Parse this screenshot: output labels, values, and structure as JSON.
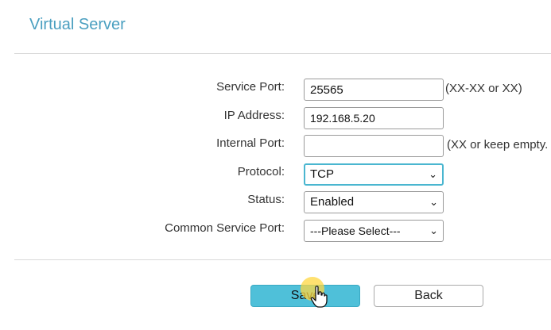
{
  "header": {
    "title": "Virtual Server"
  },
  "form": {
    "service_port": {
      "label": "Service Port:",
      "value": "25565",
      "hint": "(XX-XX or XX)"
    },
    "ip_address": {
      "label": "IP Address:",
      "value": "192.168.5.20"
    },
    "internal_port": {
      "label": "Internal Port:",
      "value": "",
      "hint": "(XX or keep empty."
    },
    "protocol": {
      "label": "Protocol:",
      "selected": "TCP"
    },
    "status": {
      "label": "Status:",
      "selected": "Enabled"
    },
    "common_service_port": {
      "label": "Common Service Port:",
      "selected": "---Please Select---"
    }
  },
  "buttons": {
    "save": "Save",
    "back": "Back"
  },
  "icons": {
    "dropdown": "chevron-down-icon",
    "cursor": "hand-pointer-icon"
  },
  "colors": {
    "title": "#4a9fc0",
    "accent": "#4fc0d9",
    "focus_border": "#4ab6d0"
  }
}
